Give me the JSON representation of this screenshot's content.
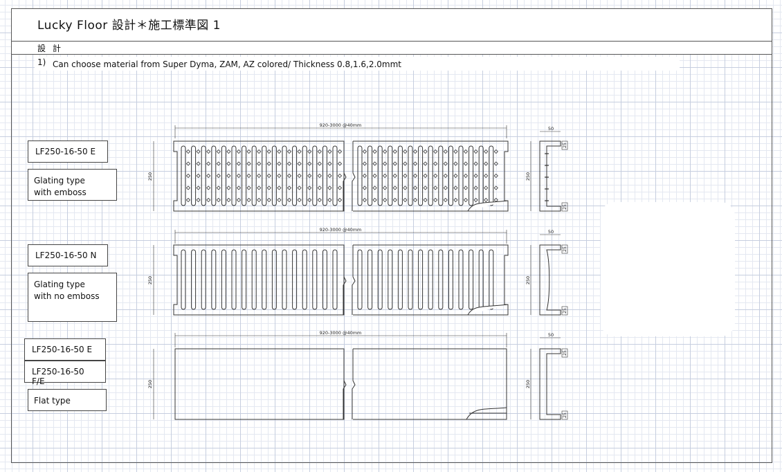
{
  "title": "Lucky Floor  設計＊施工標準図 1",
  "section": "設計",
  "note": {
    "number": "1)",
    "text": "Can choose material from Super Dyma, ZAM, AZ colored/ Thickness 0.8,1.6,2.0mmt"
  },
  "panels": [
    {
      "codes": [
        "LF250-16-50 E"
      ],
      "description": [
        "Glating type",
        "with emboss"
      ],
      "dims": {
        "length": "920-3000 @40mm",
        "height": "250",
        "depth": "50",
        "lip_top": "25",
        "lip_bottom": "25"
      }
    },
    {
      "codes": [
        "LF250-16-50 N"
      ],
      "description": [
        "Glating type",
        "with no emboss"
      ],
      "dims": {
        "length": "920-3000 @40mm",
        "height": "250",
        "depth": "50",
        "lip_top": "25",
        "lip_bottom": "25"
      }
    },
    {
      "codes": [
        "LF250-16-50 E",
        "LF250-16-50 F/E"
      ],
      "description": [
        "Flat type"
      ],
      "dims": {
        "length": "920-3000 @40mm",
        "height": "250",
        "depth": "50",
        "lip_top": "25",
        "lip_bottom": "25"
      }
    }
  ]
}
